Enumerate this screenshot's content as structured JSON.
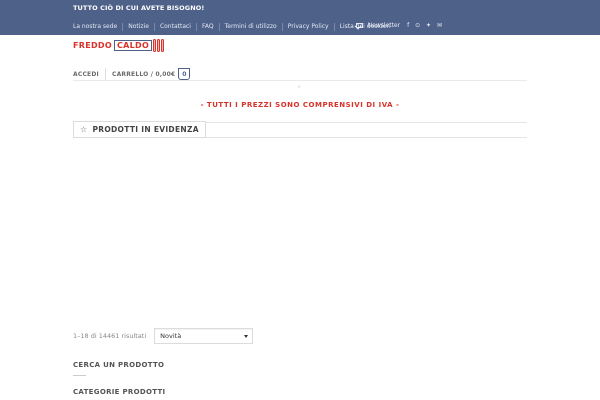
{
  "topbar": {
    "tagline": "TUTTO CIÒ DI CUI AVETE BISOGNO!",
    "nav": [
      {
        "label": "La nostra sede"
      },
      {
        "label": "Notizie"
      },
      {
        "label": "Contattaci"
      },
      {
        "label": "FAQ"
      },
      {
        "label": "Termini di utilizzo"
      },
      {
        "label": "Privacy Policy"
      },
      {
        "label": "Lista dei desideri"
      }
    ],
    "newsletter_label": "Newsletter",
    "social_icons": "f ⊙ ✦ ✉"
  },
  "logo": {
    "left": "FREDDO",
    "right": "CALDO"
  },
  "account": {
    "login_label": "ACCEDI",
    "cart_label": "CARRELLO / 0,00€",
    "cart_count": "0"
  },
  "loader": "⁘",
  "tax_notice": "- TUTTI I PREZZI SONO COMPRENSIVI DI IVA -",
  "featured": {
    "title": "PRODOTTI IN EVIDENZA"
  },
  "results": {
    "count_text": "1–18 di 14461 risultati",
    "sort_selected": "Novità"
  },
  "widgets": {
    "search_title": "CERCA UN PRODOTTO",
    "categories_title": "CATEGORIE PRODOTTI"
  },
  "colors": {
    "topbar_bg": "#4e6189",
    "accent_red": "#d9322b"
  }
}
